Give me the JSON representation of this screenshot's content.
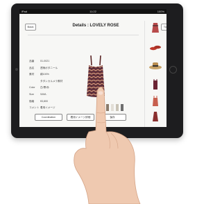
{
  "status": {
    "left": "iPad",
    "time": "11:22",
    "right": "100%"
  },
  "nav": {
    "back_label": "Back",
    "title": "Details : LOVELY ROSE",
    "top_label": "Top"
  },
  "details": [
    {
      "label": "品番",
      "value": "01-0021"
    },
    {
      "label": "品名",
      "value": "透柄ボタニール"
    },
    {
      "label": "素材",
      "value": "綿100%"
    },
    {
      "label": "",
      "value": "タタンカルメラ素材"
    },
    {
      "label": "Color",
      "value": "白/黒/赤"
    },
    {
      "label": "Size",
      "value": "S/M/L"
    },
    {
      "label": "価格",
      "value": "¥3,800"
    },
    {
      "label": "コメント",
      "value": "着用イメージ"
    }
  ],
  "buttons": {
    "coordinate": "Coordination",
    "detail": "着用イメージ詳細",
    "cart": "保存"
  },
  "colors": [
    "#222222",
    "#8a7a6a",
    "#e2ded6",
    "#c9c3b6",
    "#6e6e6e"
  ]
}
